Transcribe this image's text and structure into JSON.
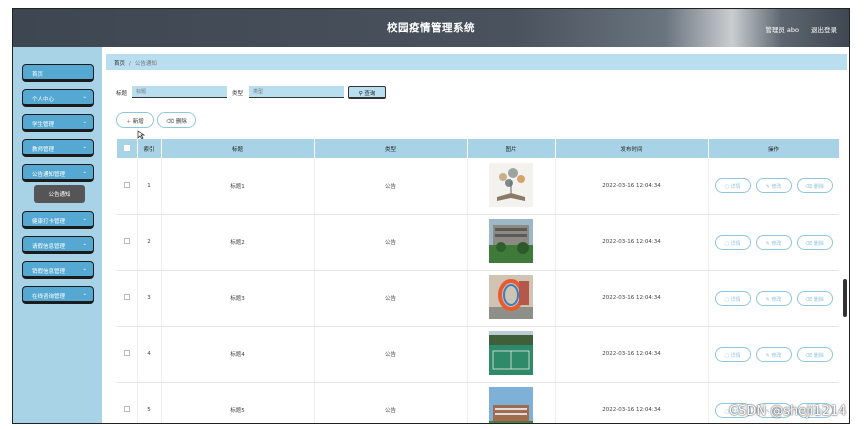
{
  "header": {
    "title": "校园疫情管理系统",
    "user": "管理员 abo",
    "logout": "退出登录"
  },
  "sidebar": {
    "items": [
      {
        "label": "首页",
        "chevron": false
      },
      {
        "label": "个人中心",
        "chevron": true
      },
      {
        "label": "学生管理",
        "chevron": true
      },
      {
        "label": "教师管理",
        "chevron": true
      },
      {
        "label": "公告通知管理",
        "chevron": true
      },
      {
        "label": "健康打卡管理",
        "chevron": true
      },
      {
        "label": "请假信息管理",
        "chevron": true
      },
      {
        "label": "销假信息管理",
        "chevron": true
      },
      {
        "label": "在线咨询管理",
        "chevron": true
      }
    ],
    "submenu": {
      "label": "公告通知"
    }
  },
  "breadcrumb": {
    "home": "首页",
    "sep": "/",
    "current": "公告通知"
  },
  "filters": {
    "title_label": "标题",
    "title_placeholder": "标题",
    "type_label": "类型",
    "type_placeholder": "类型",
    "search_label": "查询",
    "search_icon": "search-icon"
  },
  "actions": {
    "add_label": "新增",
    "delete_label": "删除"
  },
  "table": {
    "headers": [
      "",
      "索引",
      "标题",
      "类型",
      "图片",
      "发布时间",
      "操作"
    ],
    "rows": [
      {
        "index": "1",
        "title": "标题1",
        "type": "公告",
        "time": "2022-03-16 12:04:34",
        "image": "book-illustration"
      },
      {
        "index": "2",
        "title": "标题2",
        "type": "公告",
        "time": "2022-03-16 12:04:34",
        "image": "campus-building"
      },
      {
        "index": "3",
        "title": "标题3",
        "type": "公告",
        "time": "2022-03-16 12:04:34",
        "image": "campus-sculpture"
      },
      {
        "index": "4",
        "title": "标题4",
        "type": "公告",
        "time": "2022-03-16 12:04:34",
        "image": "sports-court"
      },
      {
        "index": "5",
        "title": "标题5",
        "type": "公告",
        "time": "2022-03-16 12:04:34",
        "image": "campus-view"
      }
    ],
    "op_labels": {
      "detail": "详情",
      "edit": "修改",
      "delete": "删除"
    }
  },
  "watermark": "CSDN @sheji1214",
  "colors": {
    "sidebar": "#a8d3e6",
    "menu_item": "#55a8d1",
    "header_bg": "#b8def0",
    "accent": "#8fc6de"
  }
}
